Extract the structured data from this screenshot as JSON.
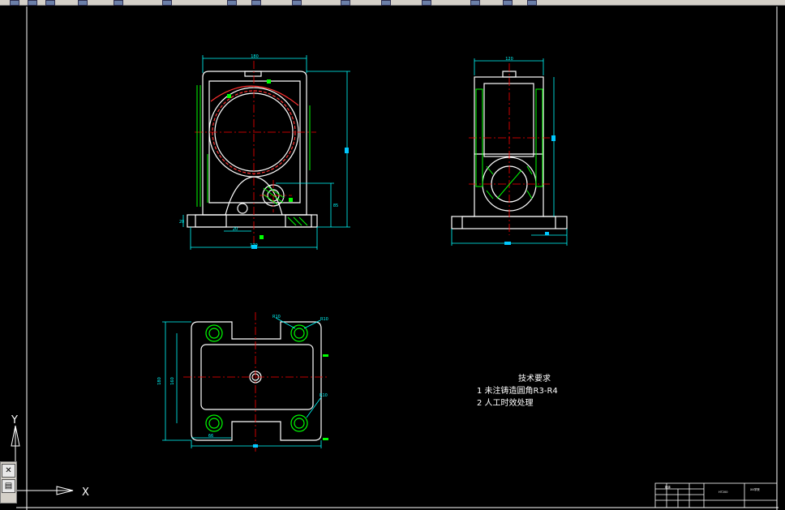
{
  "toolbar": {
    "icons": [
      "new-icon",
      "open-icon",
      "save-icon",
      "print-icon",
      "cut-icon",
      "copy-icon",
      "paste-icon",
      "undo-icon",
      "redo-icon",
      "pan-icon",
      "zoom-icon",
      "properties-icon",
      "layer-icon",
      "match-icon",
      "help-icon"
    ]
  },
  "drawing": {
    "tech_title": "技术要求",
    "tech_items": [
      "1  未注铸造圆角R3-R4",
      "2  人工时效处理"
    ],
    "dim_front_width": "180",
    "dim_front_base": "170",
    "dim_front_small": "20",
    "dim_front_height": "85",
    "dim_front_left": "20",
    "dim_side_width": "120",
    "dim_plan_w": "115",
    "dim_plan_h": "180",
    "dim_plan_h2": "160",
    "dim_plan_bottom": "66",
    "dim_r10_a": "R10",
    "dim_r10_b": "R10",
    "dim_r10_c": "R10",
    "title_block_label1": "箱体",
    "title_block_label2": "HT200",
    "title_block_label3": "XX学院"
  },
  "ucs": {
    "x_label": "X",
    "y_label": "Y"
  },
  "colors": {
    "background": "#000000",
    "outline": "#ffffff",
    "dimension": "#00ffff",
    "center": "#ff0000",
    "hatch": "#00ff00",
    "marker": "#00c8ff"
  }
}
